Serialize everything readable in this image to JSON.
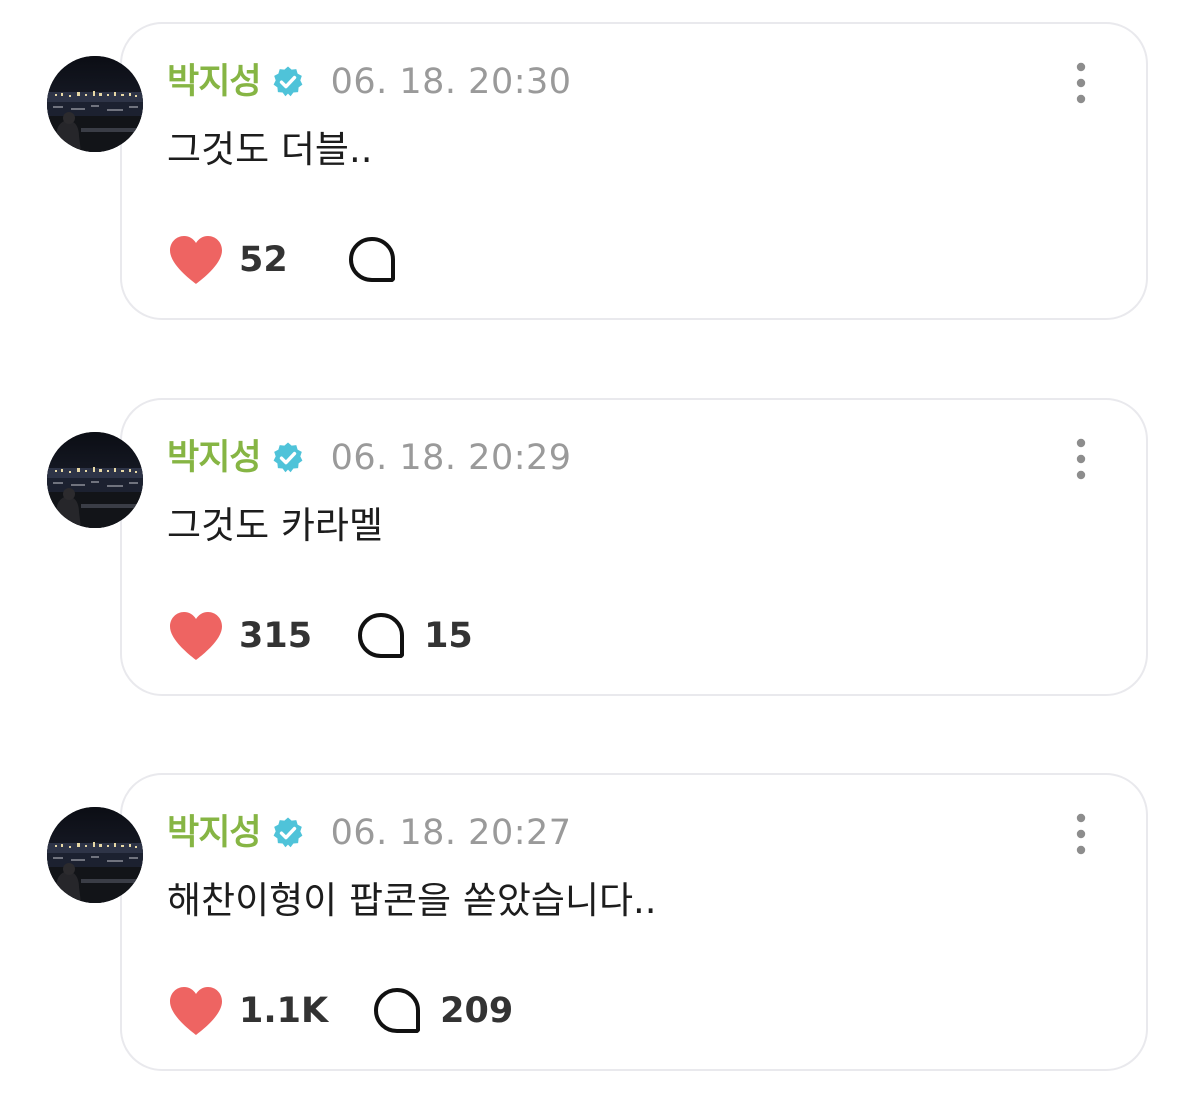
{
  "accent": {
    "author_color": "#86b544",
    "verified_color": "#4fc3d9",
    "like_color": "#ee6462",
    "timestamp_color": "#9a9a9a"
  },
  "posts": [
    {
      "author": "박지성",
      "verified_icon": "verified-badge-icon",
      "timestamp": "06. 18. 20:30",
      "text": "그것도 더블..",
      "likes": "52",
      "replies": ""
    },
    {
      "author": "박지성",
      "verified_icon": "verified-badge-icon",
      "timestamp": "06. 18. 20:29",
      "text": "그것도 카라멜",
      "likes": "315",
      "replies": "15"
    },
    {
      "author": "박지성",
      "verified_icon": "verified-badge-icon",
      "timestamp": "06. 18. 20:27",
      "text": "해찬이형이 팝콘을 쏟았습니다..",
      "likes": "1.1K",
      "replies": "209"
    }
  ]
}
